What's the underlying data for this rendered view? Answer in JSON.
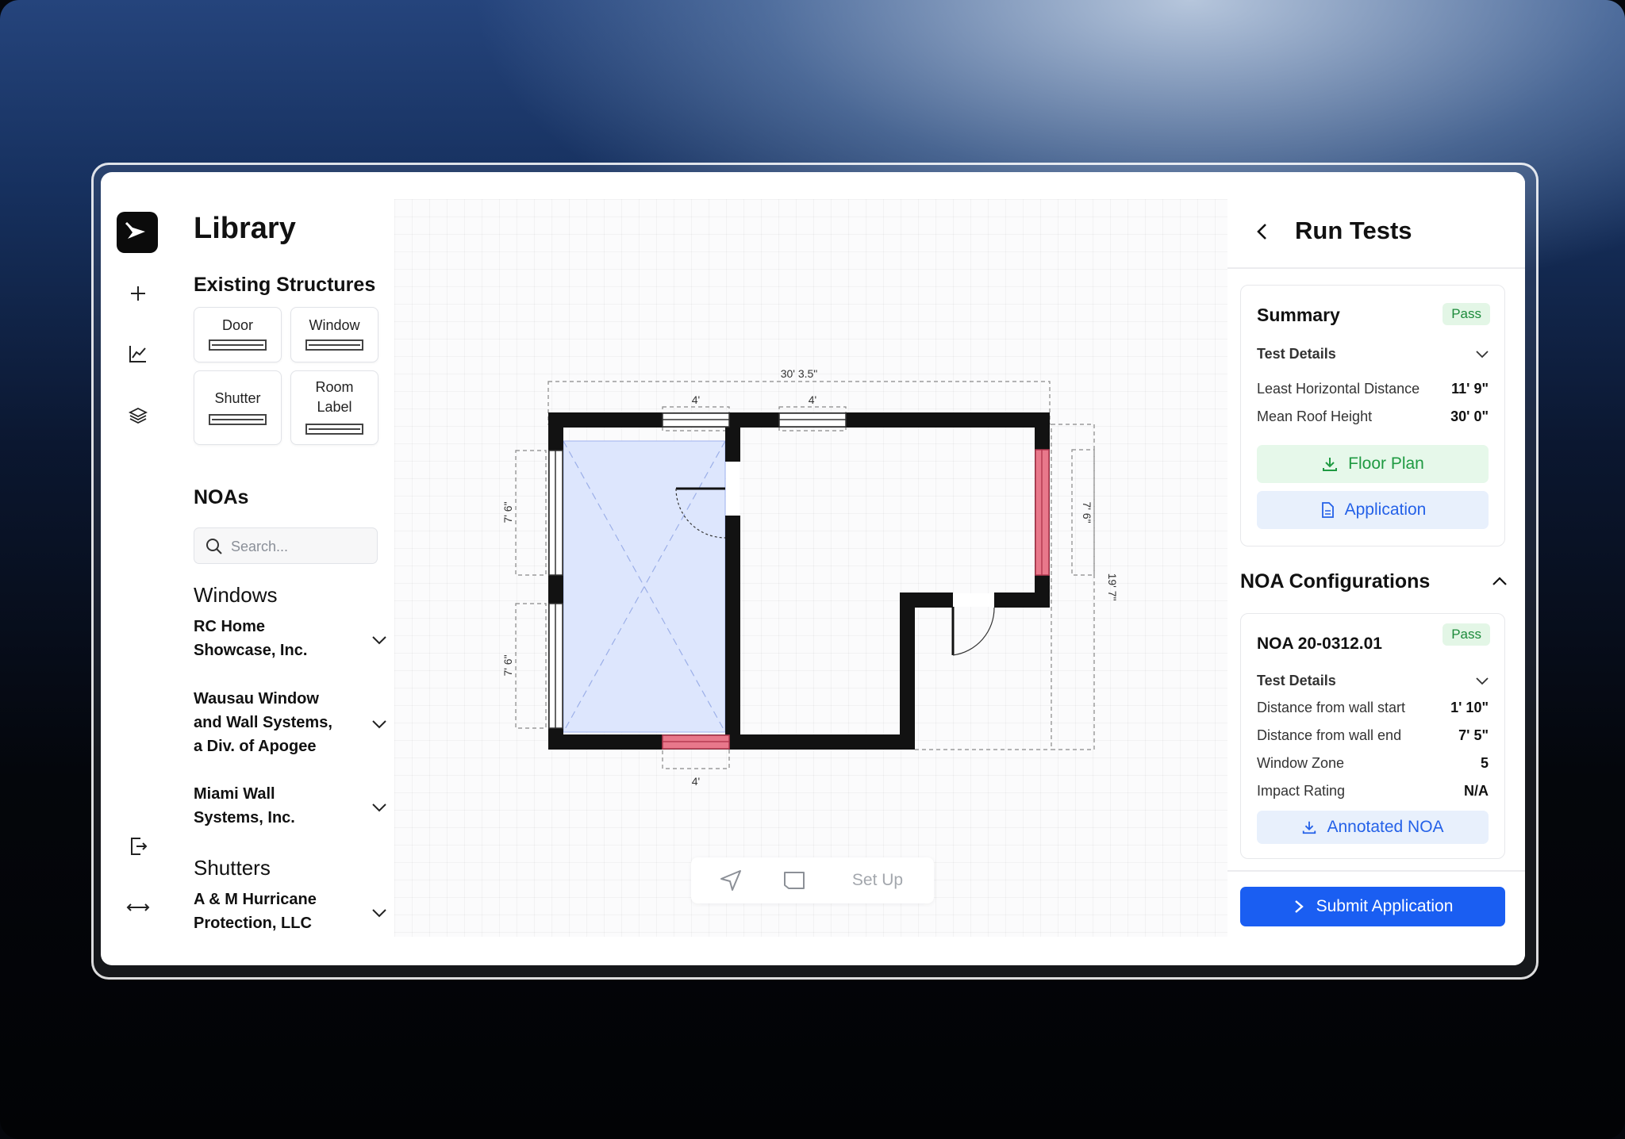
{
  "library": {
    "title": "Library",
    "existing_title": "Existing Structures",
    "structures": [
      "Door",
      "Window",
      "Shutter",
      "Room Label"
    ],
    "noas_title": "NOAs",
    "search_placeholder": "Search...",
    "windows_title": "Windows",
    "window_vendors": [
      "RC Home Showcase, Inc.",
      "Wausau Window and Wall Systems, a Div. of Apogee",
      "Miami Wall Systems, Inc."
    ],
    "shutters_title": "Shutters",
    "shutter_vendors": [
      "A & M Hurricane Protection, LLC"
    ]
  },
  "rail": {
    "icons": [
      "logo-icon",
      "plus-icon",
      "chart-icon",
      "layers-icon",
      "exit-icon",
      "resize-icon"
    ]
  },
  "plan": {
    "overall_width": "30' 3.5\"",
    "top_window_a": "4'",
    "top_window_b": "4'",
    "left_window_upper": "7' 6\"",
    "left_window_lower": "7' 6\"",
    "right_window": "7' 6\"",
    "right_height": "19' 7\"",
    "bottom_window": "4'"
  },
  "toolbar": {
    "setup_label": "Set Up"
  },
  "run_tests": {
    "title": "Run Tests",
    "summary": {
      "title": "Summary",
      "status": "Pass",
      "details_label": "Test Details",
      "rows": [
        {
          "label": "Least Horizontal Distance",
          "value": "11' 9\""
        },
        {
          "label": "Mean Roof Height",
          "value": "30' 0\""
        }
      ],
      "floor_plan_button": "Floor Plan",
      "application_button": "Application"
    },
    "noa_section_title": "NOA Configurations",
    "noa": {
      "title": "NOA 20-0312.01",
      "status": "Pass",
      "details_label": "Test Details",
      "rows": [
        {
          "label": "Distance from wall start",
          "value": "1' 10\""
        },
        {
          "label": "Distance from wall end",
          "value": "7' 5\""
        },
        {
          "label": "Window Zone",
          "value": "5"
        },
        {
          "label": "Impact Rating",
          "value": "N/A"
        }
      ],
      "annotated_button": "Annotated NOA"
    },
    "submit_button": "Submit Application"
  },
  "colors": {
    "accent": "#1a5ef2",
    "pass_green": "#1c8a3a",
    "room_fill": "#dde6fd",
    "shutter_red": "#e46a7e"
  }
}
